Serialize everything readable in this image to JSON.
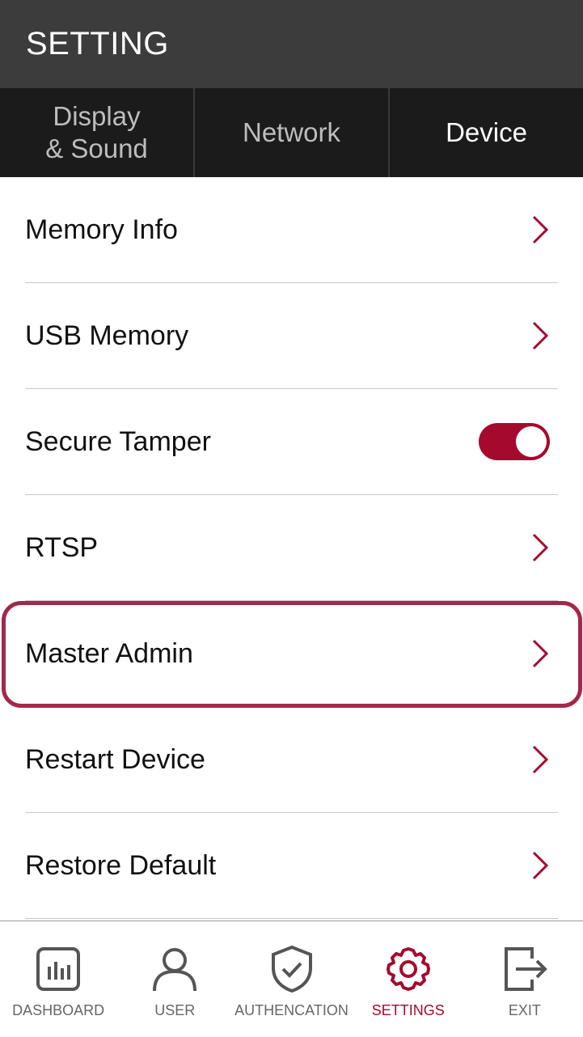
{
  "header": {
    "title": "SETTING"
  },
  "tabs": [
    {
      "label": "Display\n& Sound",
      "active": false
    },
    {
      "label": "Network",
      "active": false
    },
    {
      "label": "Device",
      "active": true
    }
  ],
  "rows": [
    {
      "label": "Memory Info",
      "control": "chevron"
    },
    {
      "label": "USB Memory",
      "control": "chevron"
    },
    {
      "label": "Secure Tamper",
      "control": "toggle",
      "toggle_on": true
    },
    {
      "label": "RTSP",
      "control": "chevron"
    },
    {
      "label": "Master Admin",
      "control": "chevron",
      "highlighted": true
    },
    {
      "label": "Restart Device",
      "control": "chevron"
    },
    {
      "label": "Restore Default",
      "control": "chevron"
    }
  ],
  "bottom_nav": [
    {
      "label": "DASHBOARD",
      "icon": "dashboard-icon"
    },
    {
      "label": "USER",
      "icon": "user-icon"
    },
    {
      "label": "AUTHENCATION",
      "icon": "shield-check-icon"
    },
    {
      "label": "SETTINGS",
      "icon": "gear-icon",
      "active": true
    },
    {
      "label": "EXIT",
      "icon": "exit-icon"
    }
  ],
  "colors": {
    "accent": "#a50a2e",
    "highlight_border": "#a3284a",
    "header_bg": "#3c3c3c",
    "tabs_bg": "#1b1b1b"
  }
}
